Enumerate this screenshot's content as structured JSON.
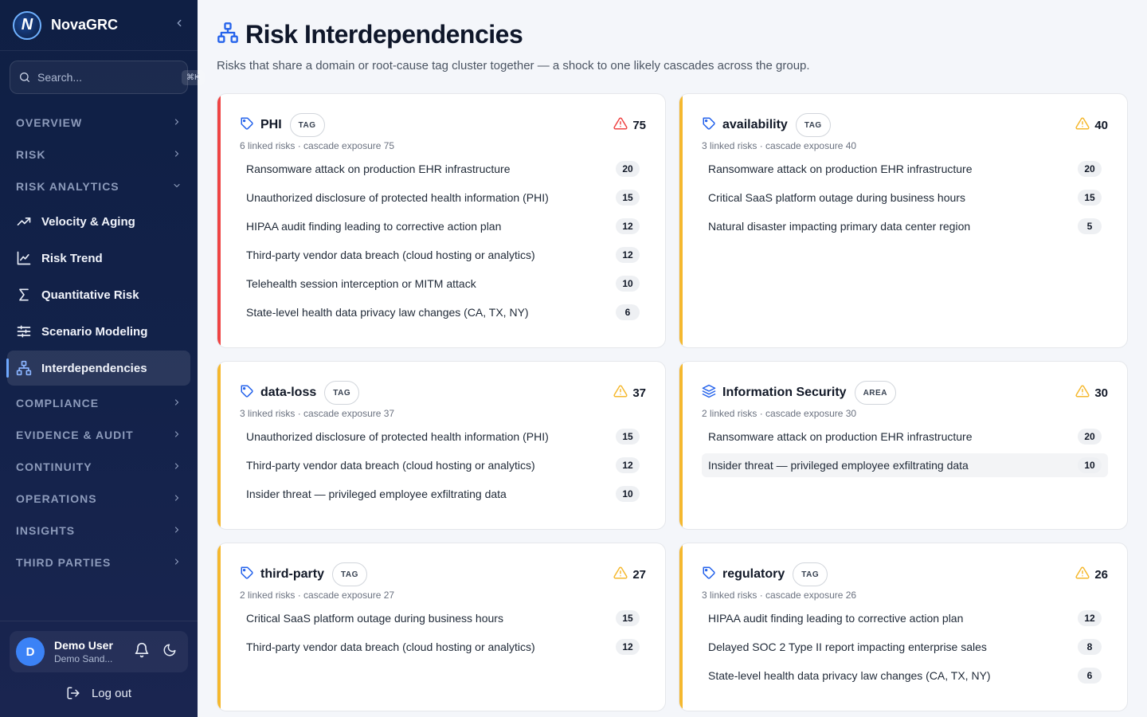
{
  "brand": {
    "name": "NovaGRC",
    "logo_letter": "N"
  },
  "search": {
    "placeholder": "Search...",
    "shortcut": "⌘K"
  },
  "nav": {
    "sections_top": [
      "OVERVIEW",
      "RISK",
      "RISK ANALYTICS"
    ],
    "items": [
      {
        "label": "Velocity & Aging",
        "icon": "trending-up-icon"
      },
      {
        "label": "Risk Trend",
        "icon": "line-chart-icon"
      },
      {
        "label": "Quantitative Risk",
        "icon": "sigma-icon"
      },
      {
        "label": "Scenario Modeling",
        "icon": "sliders-icon"
      },
      {
        "label": "Interdependencies",
        "icon": "network-icon",
        "active": true
      }
    ],
    "sections_bottom": [
      "COMPLIANCE",
      "EVIDENCE & AUDIT",
      "CONTINUITY",
      "OPERATIONS",
      "INSIGHTS",
      "THIRD PARTIES"
    ]
  },
  "user": {
    "initial": "D",
    "name": "Demo User",
    "org": "Demo Sand...",
    "logout_label": "Log out"
  },
  "page": {
    "title": "Risk Interdependencies",
    "subtitle": "Risks that share a domain or root-cause tag cluster together — a shock to one likely cascades across the group."
  },
  "colors": {
    "red": "#ef4444",
    "amber": "#f5b82e",
    "accent": "#2563eb"
  },
  "clusters": [
    {
      "title": "PHI",
      "kind": "TAG",
      "icon": "tag-icon",
      "score": "75",
      "severity": "red",
      "meta": "6 linked risks · cascade exposure 75",
      "risks": [
        {
          "name": "Ransomware attack on production EHR infrastructure",
          "score": "20"
        },
        {
          "name": "Unauthorized disclosure of protected health information (PHI)",
          "score": "15"
        },
        {
          "name": "HIPAA audit finding leading to corrective action plan",
          "score": "12"
        },
        {
          "name": "Third-party vendor data breach (cloud hosting or analytics)",
          "score": "12"
        },
        {
          "name": "Telehealth session interception or MITM attack",
          "score": "10"
        },
        {
          "name": "State-level health data privacy law changes (CA, TX, NY)",
          "score": "6"
        }
      ]
    },
    {
      "title": "availability",
      "kind": "TAG",
      "icon": "tag-icon",
      "score": "40",
      "severity": "amber",
      "meta": "3 linked risks · cascade exposure 40",
      "risks": [
        {
          "name": "Ransomware attack on production EHR infrastructure",
          "score": "20"
        },
        {
          "name": "Critical SaaS platform outage during business hours",
          "score": "15"
        },
        {
          "name": "Natural disaster impacting primary data center region",
          "score": "5"
        }
      ]
    },
    {
      "title": "data-loss",
      "kind": "TAG",
      "icon": "tag-icon",
      "score": "37",
      "severity": "amber",
      "meta": "3 linked risks · cascade exposure 37",
      "risks": [
        {
          "name": "Unauthorized disclosure of protected health information (PHI)",
          "score": "15"
        },
        {
          "name": "Third-party vendor data breach (cloud hosting or analytics)",
          "score": "12"
        },
        {
          "name": "Insider threat — privileged employee exfiltrating data",
          "score": "10"
        }
      ]
    },
    {
      "title": "Information Security",
      "kind": "AREA",
      "icon": "layers-icon",
      "score": "30",
      "severity": "amber",
      "meta": "2 linked risks · cascade exposure 30",
      "risks": [
        {
          "name": "Ransomware attack on production EHR infrastructure",
          "score": "20"
        },
        {
          "name": "Insider threat — privileged employee exfiltrating data",
          "score": "10",
          "highlight": true
        }
      ]
    },
    {
      "title": "third-party",
      "kind": "TAG",
      "icon": "tag-icon",
      "score": "27",
      "severity": "amber",
      "meta": "2 linked risks · cascade exposure 27",
      "risks": [
        {
          "name": "Critical SaaS platform outage during business hours",
          "score": "15"
        },
        {
          "name": "Third-party vendor data breach (cloud hosting or analytics)",
          "score": "12"
        }
      ]
    },
    {
      "title": "regulatory",
      "kind": "TAG",
      "icon": "tag-icon",
      "score": "26",
      "severity": "amber",
      "meta": "3 linked risks · cascade exposure 26",
      "risks": [
        {
          "name": "HIPAA audit finding leading to corrective action plan",
          "score": "12"
        },
        {
          "name": "Delayed SOC 2 Type II report impacting enterprise sales",
          "score": "8"
        },
        {
          "name": "State-level health data privacy law changes (CA, TX, NY)",
          "score": "6"
        }
      ]
    }
  ]
}
